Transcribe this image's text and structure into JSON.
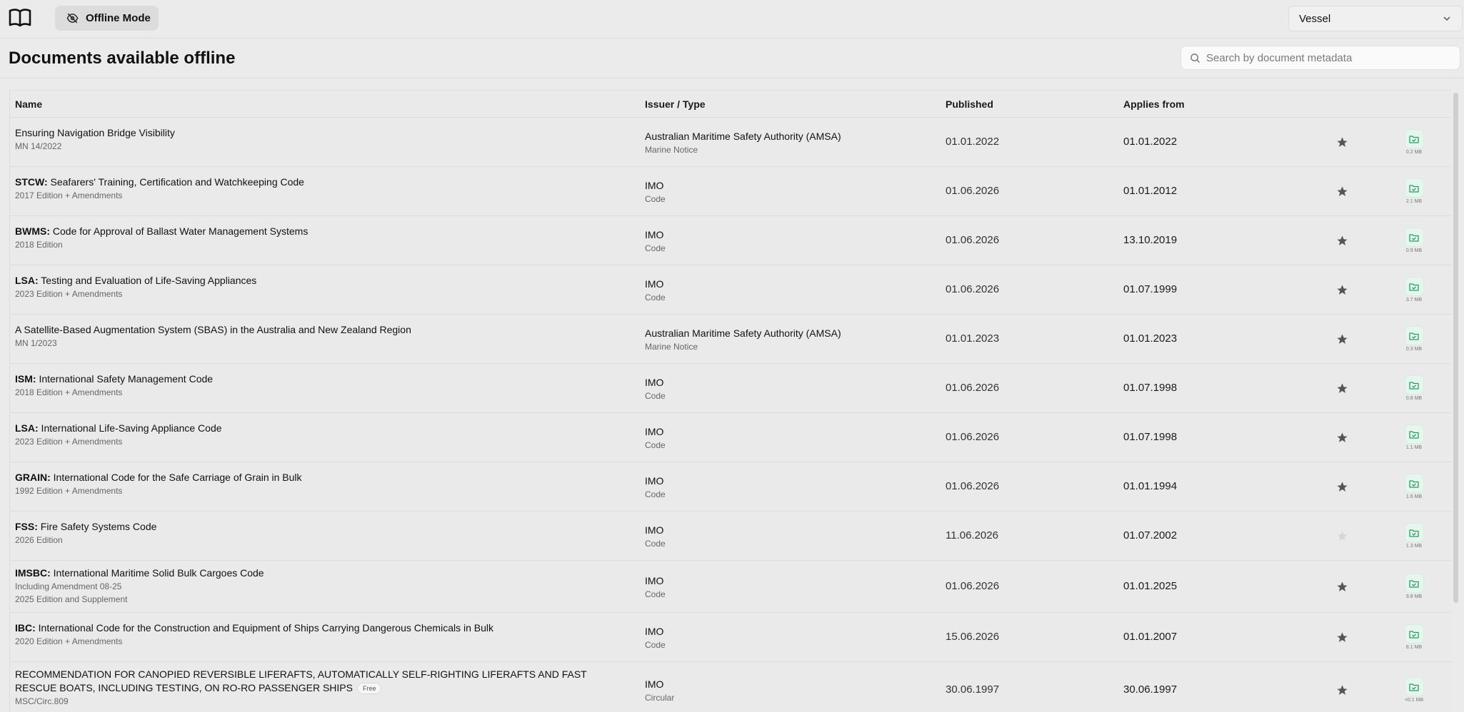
{
  "topbar": {
    "logo_icon": "book-open-icon",
    "offline_label": "Offline Mode",
    "offline_icon": "eye-off-icon",
    "vessel_value": "Vessel"
  },
  "page": {
    "title": "Documents available offline",
    "search_placeholder": "Search by document metadata"
  },
  "table": {
    "headers": {
      "name": "Name",
      "issuer": "Issuer / Type",
      "published": "Published",
      "applies": "Applies from"
    },
    "rows": [
      {
        "code": "",
        "title": "Ensuring Navigation Bridge Visibility",
        "sub1": "MN 14/2022",
        "sub2": "",
        "issuer": "Australian Maritime Safety Authority (AMSA)",
        "type": "Marine Notice",
        "published": "01.01.2022",
        "applies": "01.01.2022",
        "starred": true,
        "size": "0.2 MB"
      },
      {
        "code": "STCW:",
        "title": " Seafarers' Training, Certification and Watchkeeping Code",
        "sub1": "2017 Edition + Amendments",
        "sub2": "",
        "issuer": "IMO",
        "type": "Code",
        "published": "01.06.2026",
        "applies": "01.01.2012",
        "starred": true,
        "size": "2.1 MB"
      },
      {
        "code": "BWMS:",
        "title": " Code for Approval of Ballast Water Management Systems",
        "sub1": "2018 Edition",
        "sub2": "",
        "issuer": "IMO",
        "type": "Code",
        "published": "01.06.2026",
        "applies": "13.10.2019",
        "starred": true,
        "size": "0.9 MB"
      },
      {
        "code": "LSA:",
        "title": " Testing and Evaluation of Life-Saving Appliances",
        "sub1": "2023 Edition + Amendments",
        "sub2": "",
        "issuer": "IMO",
        "type": "Code",
        "published": "01.06.2026",
        "applies": "01.07.1999",
        "starred": true,
        "size": "3.7 MB"
      },
      {
        "code": "",
        "title": "A Satellite-Based Augmentation System (SBAS) in the Australia and New Zealand Region",
        "sub1": "MN 1/2023",
        "sub2": "",
        "issuer": "Australian Maritime Safety Authority (AMSA)",
        "type": "Marine Notice",
        "published": "01.01.2023",
        "applies": "01.01.2023",
        "starred": true,
        "size": "0.3 MB"
      },
      {
        "code": "ISM:",
        "title": " International Safety Management Code",
        "sub1": "2018 Edition + Amendments",
        "sub2": "",
        "issuer": "IMO",
        "type": "Code",
        "published": "01.06.2026",
        "applies": "01.07.1998",
        "starred": true,
        "size": "0.8 MB"
      },
      {
        "code": "LSA:",
        "title": " International Life-Saving Appliance Code",
        "sub1": "2023 Edition + Amendments",
        "sub2": "",
        "issuer": "IMO",
        "type": "Code",
        "published": "01.06.2026",
        "applies": "01.07.1998",
        "starred": true,
        "size": "1.1 MB"
      },
      {
        "code": "GRAIN:",
        "title": " International Code for the Safe Carriage of Grain in Bulk",
        "sub1": "1992 Edition + Amendments",
        "sub2": "",
        "issuer": "IMO",
        "type": "Code",
        "published": "01.06.2026",
        "applies": "01.01.1994",
        "starred": true,
        "size": "1.6 MB"
      },
      {
        "code": "FSS:",
        "title": " Fire Safety Systems Code",
        "sub1": "2026 Edition",
        "sub2": "",
        "issuer": "IMO",
        "type": "Code",
        "published": "11.06.2026",
        "applies": "01.07.2002",
        "starred": false,
        "size": "1.3 MB"
      },
      {
        "code": "IMSBC:",
        "title": " International Maritime Solid Bulk Cargoes Code",
        "sub1": "Including Amendment 08-25",
        "sub2": "2025 Edition and Supplement",
        "issuer": "IMO",
        "type": "Code",
        "published": "01.06.2026",
        "applies": "01.01.2025",
        "starred": true,
        "size": "9.8 MB"
      },
      {
        "code": "IBC:",
        "title": " International Code for the Construction and Equipment of Ships Carrying Dangerous Chemicals in Bulk",
        "sub1": "2020 Edition + Amendments",
        "sub2": "",
        "issuer": "IMO",
        "type": "Code",
        "published": "15.06.2026",
        "applies": "01.01.2007",
        "starred": true,
        "size": "8.1 MB"
      },
      {
        "code": "",
        "title": "RECOMMENDATION FOR CANOPIED REVERSIBLE LIFERAFTS, AUTOMATICALLY SELF-RIGHTING LIFERAFTS AND FAST RESCUE BOATS, INCLUDING TESTING, ON RO-RO PASSENGER SHIPS",
        "badge": "Free",
        "sub1": "MSC/Circ.809",
        "sub2": "",
        "issuer": "IMO",
        "type": "Circular",
        "published": "30.06.1997",
        "applies": "30.06.1997",
        "starred": true,
        "size": "<0.1 MB"
      }
    ]
  },
  "colors": {
    "background": "#ebebeb",
    "accent_green": "#2a9d66",
    "star_filled": "#555555",
    "star_empty": "#d6d6d6"
  }
}
